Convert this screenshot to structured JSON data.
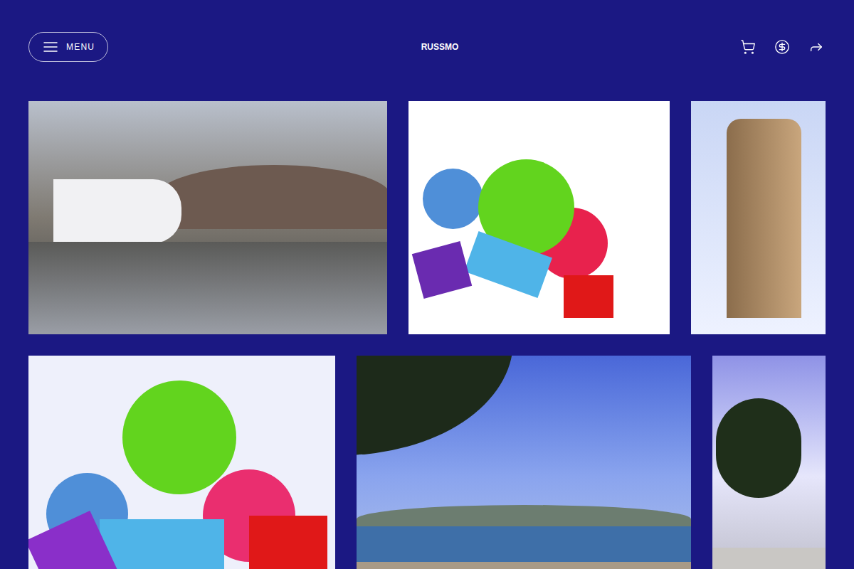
{
  "header": {
    "menu_label": "MENU",
    "brand": "RUSSMO"
  }
}
